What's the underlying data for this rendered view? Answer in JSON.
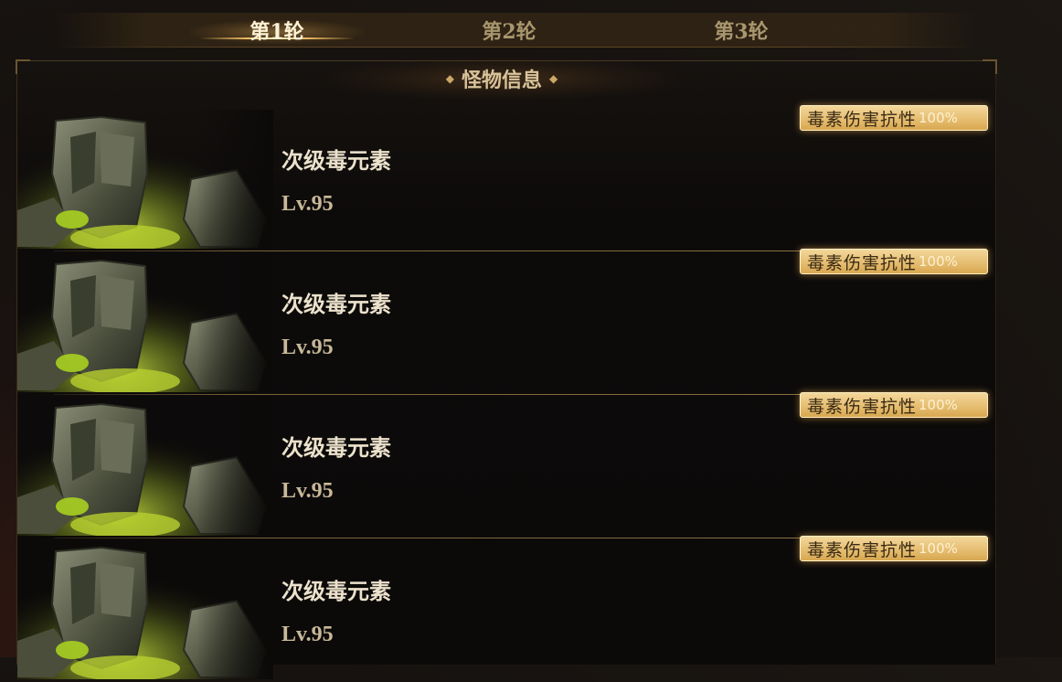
{
  "tabs": [
    {
      "label": "第1轮",
      "active": true
    },
    {
      "label": "第2轮",
      "active": false
    },
    {
      "label": "第3轮",
      "active": false
    }
  ],
  "panel": {
    "title": "怪物信息"
  },
  "monsters": [
    {
      "name": "次级毒元素",
      "level": "Lv.95",
      "badge_label": "毒素伤害抗性",
      "badge_value": "100%"
    },
    {
      "name": "次级毒元素",
      "level": "Lv.95",
      "badge_label": "毒素伤害抗性",
      "badge_value": "100%"
    },
    {
      "name": "次级毒元素",
      "level": "Lv.95",
      "badge_label": "毒素伤害抗性",
      "badge_value": "100%"
    },
    {
      "name": "次级毒元素",
      "level": "Lv.95",
      "badge_label": "毒素伤害抗性",
      "badge_value": "100%"
    }
  ],
  "colors": {
    "accent_gold": "#e6be72",
    "poison_green": "#9acd32"
  },
  "icons": {
    "portrait": "poison-elemental-portrait-icon",
    "title_ornament": "diamond-icon"
  }
}
